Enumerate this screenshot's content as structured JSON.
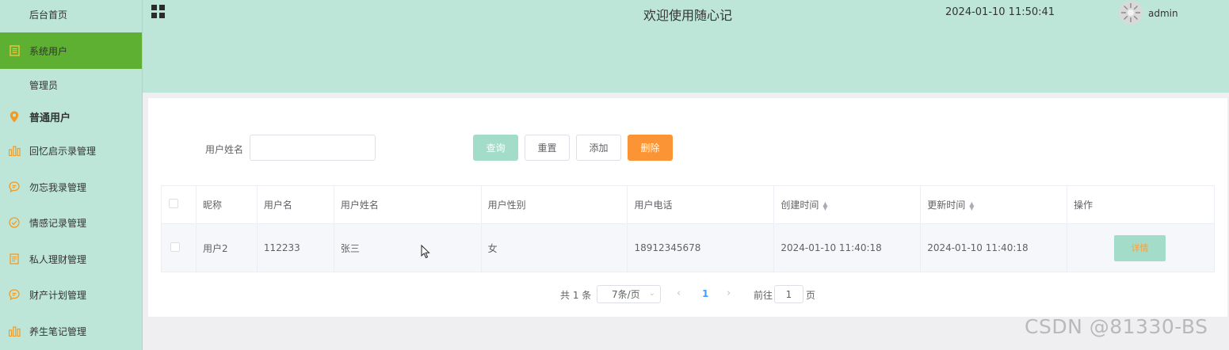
{
  "sidebar": {
    "items": [
      {
        "label": "后台首页",
        "icon": "none"
      },
      {
        "label": "系统用户",
        "icon": "document-icon",
        "active": true
      },
      {
        "label": "管理员",
        "icon": "none"
      },
      {
        "label": "普通用户",
        "icon": "location-pin-icon"
      },
      {
        "label": "回忆启示录管理",
        "icon": "bar-chart-icon"
      },
      {
        "label": "勿忘我录管理",
        "icon": "chat-bubble-icon"
      },
      {
        "label": "情感记录管理",
        "icon": "check-circle-icon"
      },
      {
        "label": "私人理财管理",
        "icon": "document-icon"
      },
      {
        "label": "财产计划管理",
        "icon": "chat-bubble-icon"
      },
      {
        "label": "养生笔记管理",
        "icon": "bar-chart-icon"
      }
    ]
  },
  "header": {
    "title": "欢迎使用随心记",
    "datetime": "2024-01-10 11:50:41",
    "username": "admin"
  },
  "search": {
    "label": "用户姓名",
    "value": "",
    "placeholder": ""
  },
  "buttons": {
    "query": "查询",
    "reset": "重置",
    "add": "添加",
    "delete": "删除"
  },
  "table": {
    "columns": [
      "昵称",
      "用户名",
      "用户姓名",
      "用户性别",
      "用户电话",
      "创建时间",
      "更新时间",
      "操作"
    ],
    "rows": [
      {
        "nickname": "用户2",
        "username": "112233",
        "realname": "张三",
        "gender": "女",
        "phone": "18912345678",
        "created": "2024-01-10 11:40:18",
        "updated": "2024-01-10 11:40:18",
        "action": "详情"
      }
    ]
  },
  "pagination": {
    "total": "共 1 条",
    "page_size": "7条/页",
    "current_page": "1",
    "goto_label": "前往",
    "goto_value": "1",
    "goto_unit": "页"
  },
  "watermark": "CSDN @81330-BS",
  "colors": {
    "sidebar_bg": "#bde6d8",
    "active_item": "#5eb033",
    "primary_button": "#a3ddc9",
    "danger_button": "#fb9435",
    "icon_orange": "#f49a22"
  }
}
